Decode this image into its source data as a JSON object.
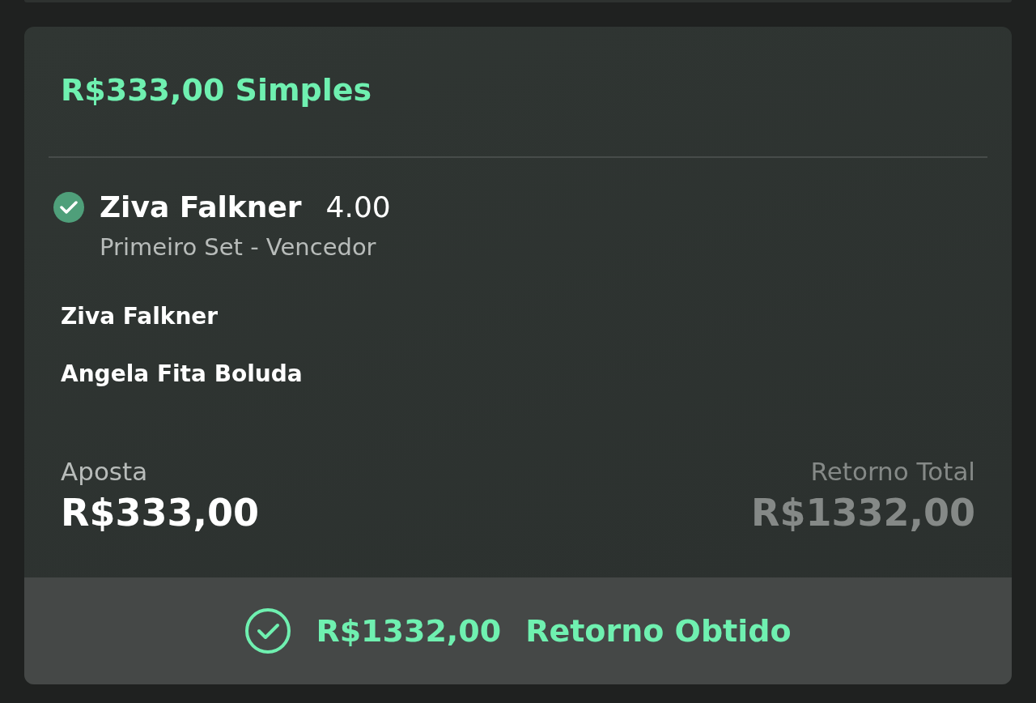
{
  "bet": {
    "title": "R$333,00 Simples",
    "selection": {
      "won": true,
      "name": "Ziva Falkner",
      "odds": "4.00",
      "market": "Primeiro Set - Vencedor"
    },
    "participants": [
      "Ziva Falkner",
      "Angela Fita Boluda"
    ],
    "stake": {
      "label": "Aposta",
      "value": "R$333,00"
    },
    "total_return": {
      "label": "Retorno Total",
      "value": "R$1332,00"
    },
    "footer": {
      "amount": "R$1332,00",
      "label": "Retorno Obtido"
    }
  }
}
